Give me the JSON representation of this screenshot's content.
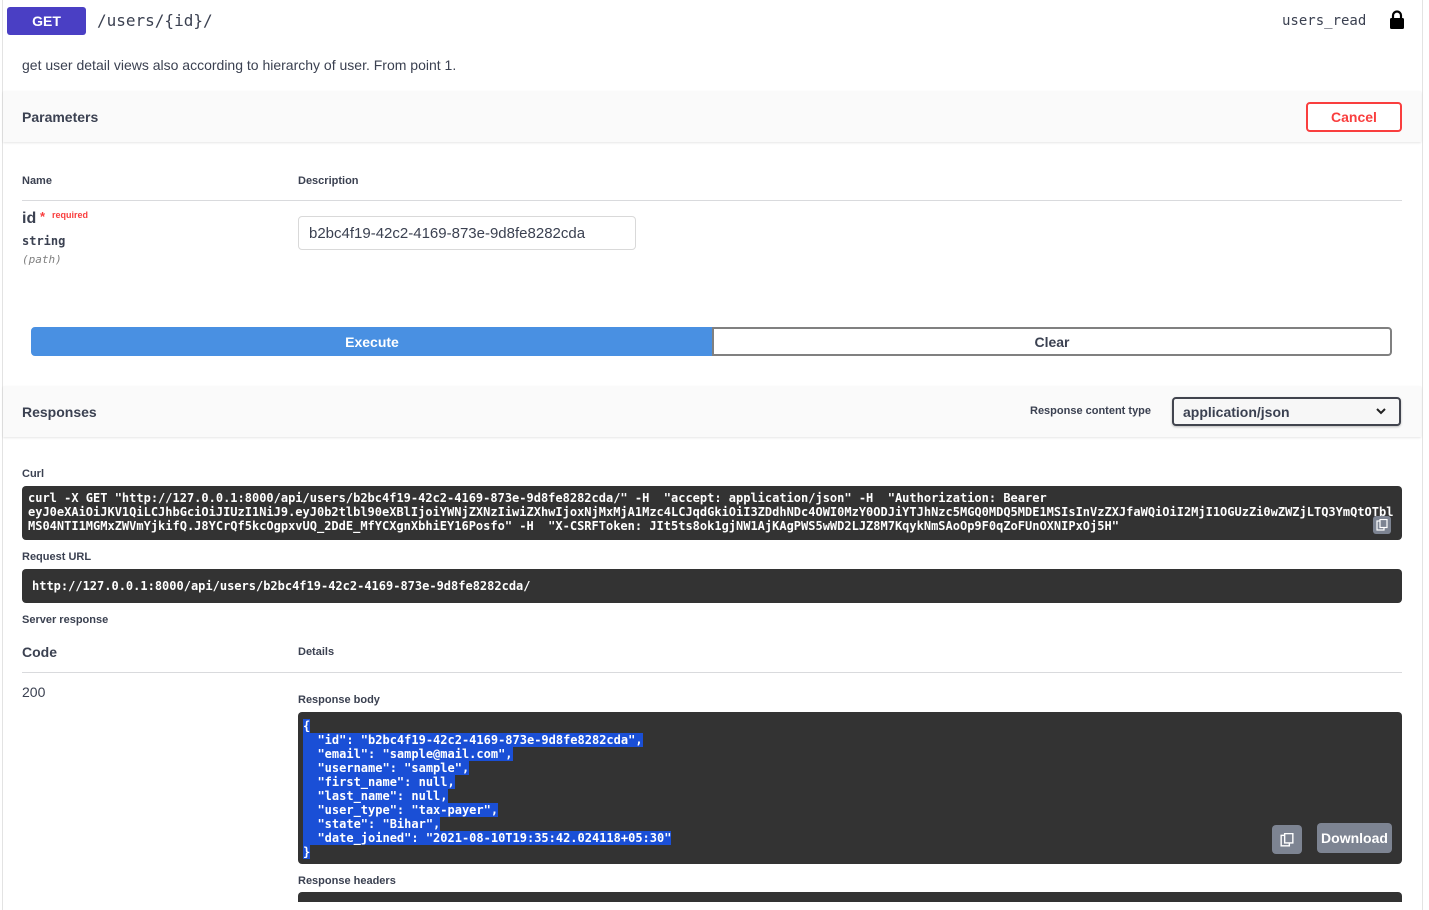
{
  "operation": {
    "method": "GET",
    "path": "/users/{id}/",
    "scope": "users_read",
    "summary": "get user detail views also according to hierarchy of user. From point 1."
  },
  "parameters": {
    "title": "Parameters",
    "cancel_label": "Cancel",
    "col_name": "Name",
    "col_description": "Description",
    "param": {
      "name": "id",
      "star": "*",
      "required_label": "required",
      "type": "string",
      "in": "(path)",
      "value": "b2bc4f19-42c2-4169-873e-9d8fe8282cda"
    }
  },
  "actions": {
    "execute_label": "Execute",
    "clear_label": "Clear"
  },
  "responses": {
    "title": "Responses",
    "content_type_label": "Response content type",
    "content_type_value": "application/json",
    "curl_label": "Curl",
    "curl_lines": [
      "curl -X GET \"http://127.0.0.1:8000/api/users/b2bc4f19-42c2-4169-873e-9d8fe8282cda/\" -H  \"accept: application/json\" -H  \"Authorization: Bearer",
      "eyJ0eXAiOiJKV1QiLCJhbGciOiJIUzI1NiJ9.eyJ0b2tlbl90eXBlIjoiYWNjZXNzIiwiZXhwIjoxNjMxMjA1Mzc4LCJqdGkiOiI3ZDdhNDc4OWI0MzY0ODJiYTJhNzc5MGQ0MDQ5MDE1MSIsInVzZXJfaWQiOiI2MjI1OGUzZi0wZWZjLTQ3YmQtOTbl",
      "MS04NTI1MGMxZWVmYjkifQ.J8YCrQf5kcOgpxvUQ_2DdE_MfYCXgnXbhiEY16Posfo\" -H  \"X-CSRFToken: JIt5ts8ok1gjNW1AjKAgPWS5wWD2LJZ8M7KqykNmSAoOp9F0qZoFUnOXNIPxOj5H\""
    ],
    "request_url_label": "Request URL",
    "request_url": "http://127.0.0.1:8000/api/users/b2bc4f19-42c2-4169-873e-9d8fe8282cda/",
    "server_response_label": "Server response",
    "code_header": "Code",
    "details_header": "Details",
    "status_code": "200",
    "response_body_label": "Response body",
    "response_body_lines": [
      "{",
      "  \"id\": \"b2bc4f19-42c2-4169-873e-9d8fe8282cda\",",
      "  \"email\": \"sample@mail.com\",",
      "  \"username\": \"sample\",",
      "  \"first_name\": null,",
      "  \"last_name\": null,",
      "  \"user_type\": \"tax-payer\",",
      "  \"state\": \"Bihar\",",
      "  \"date_joined\": \"2021-08-10T19:35:42.024118+05:30\"",
      "}"
    ],
    "download_label": "Download",
    "response_headers_label": "Response headers"
  },
  "icons": {
    "lock": "lock-icon",
    "chevron": "chevron-down-icon",
    "copy": "copy-icon"
  },
  "colors": {
    "get": "#4a3fc4",
    "execute": "#4990e2",
    "cancel": "#f93e3e",
    "selection": "#1a4fd6"
  }
}
